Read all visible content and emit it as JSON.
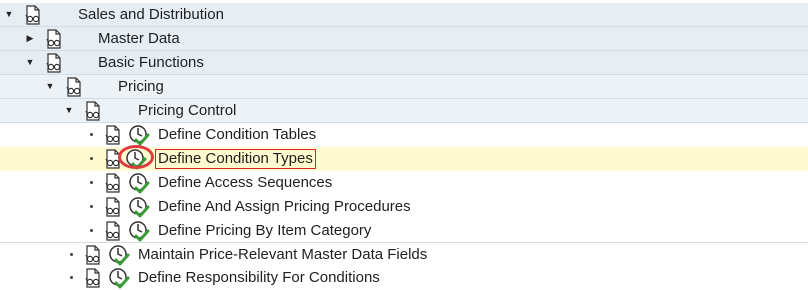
{
  "tree": {
    "sales_distribution": "Sales and Distribution",
    "master_data": "Master Data",
    "basic_functions": "Basic Functions",
    "pricing": "Pricing",
    "pricing_control": "Pricing Control",
    "define_condition_tables": "Define Condition Tables",
    "define_condition_types": "Define Condition Types",
    "define_access_sequences": "Define Access Sequences",
    "define_assign_pricing_procedures": "Define And Assign Pricing Procedures",
    "define_pricing_by_item_category": "Define Pricing By Item Category",
    "maintain_price_relevant": "Maintain Price-Relevant Master Data Fields",
    "define_responsibility": "Define Responsibility For Conditions"
  },
  "icons": {
    "doc": "spectacles-doc-icon",
    "execute": "clock-check-icon"
  },
  "colors": {
    "node_bg": "#e6eef4",
    "highlight": "#fdfbcf",
    "selection_border": "#d9232b",
    "icon_green": "#3a9a3a"
  }
}
